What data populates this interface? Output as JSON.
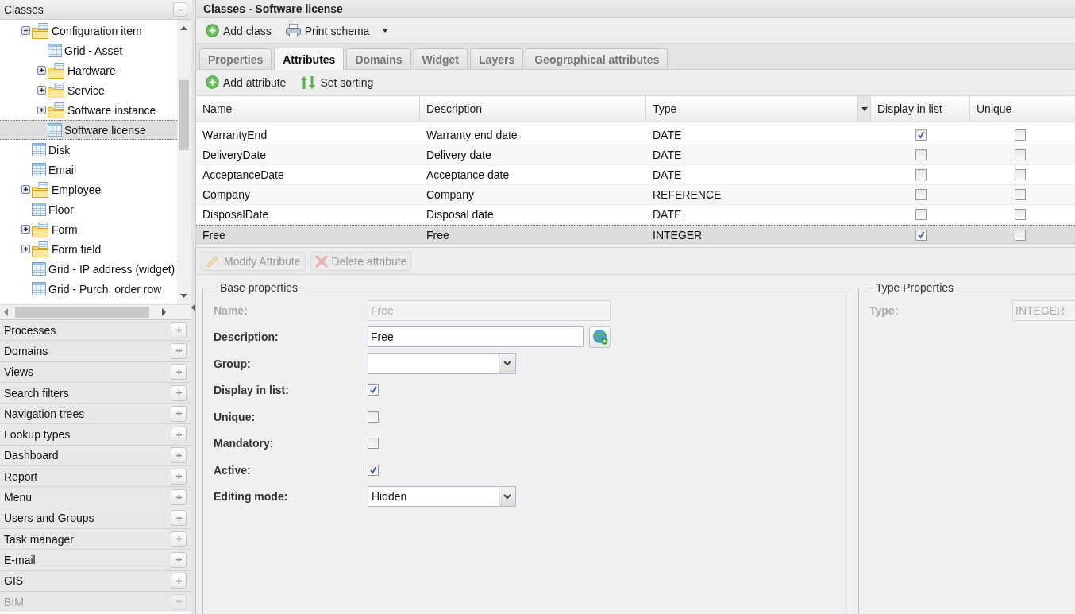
{
  "sidebar": {
    "title": "Classes",
    "tree": [
      {
        "label": "Configuration item",
        "kind": "folder",
        "expanded": true,
        "selected": false,
        "children": [
          {
            "label": "Grid - Asset",
            "kind": "class",
            "selected": false
          },
          {
            "label": "Hardware",
            "kind": "folder",
            "expanded": false,
            "selected": false
          },
          {
            "label": "Service",
            "kind": "folder",
            "expanded": false,
            "selected": false
          },
          {
            "label": "Software instance",
            "kind": "folder",
            "expanded": false,
            "selected": false
          },
          {
            "label": "Software license",
            "kind": "class",
            "selected": true
          }
        ]
      },
      {
        "label": "Disk",
        "kind": "class",
        "selected": false
      },
      {
        "label": "Email",
        "kind": "class",
        "selected": false
      },
      {
        "label": "Employee",
        "kind": "folder",
        "expanded": false,
        "selected": false
      },
      {
        "label": "Floor",
        "kind": "class",
        "selected": false
      },
      {
        "label": "Form",
        "kind": "folder",
        "expanded": false,
        "selected": false
      },
      {
        "label": "Form field",
        "kind": "folder",
        "expanded": false,
        "selected": false
      },
      {
        "label": "Grid - IP address (widget)",
        "kind": "class",
        "selected": false
      },
      {
        "label": "Grid - Purch. order row",
        "kind": "class",
        "selected": false
      }
    ],
    "sections": [
      {
        "label": "Processes",
        "disabled": false
      },
      {
        "label": "Domains",
        "disabled": false
      },
      {
        "label": "Views",
        "disabled": false
      },
      {
        "label": "Search filters",
        "disabled": false
      },
      {
        "label": "Navigation trees",
        "disabled": false
      },
      {
        "label": "Lookup types",
        "disabled": false
      },
      {
        "label": "Dashboard",
        "disabled": false
      },
      {
        "label": "Report",
        "disabled": false
      },
      {
        "label": "Menu",
        "disabled": false
      },
      {
        "label": "Users and Groups",
        "disabled": false
      },
      {
        "label": "Task manager",
        "disabled": false
      },
      {
        "label": "E-mail",
        "disabled": false
      },
      {
        "label": "GIS",
        "disabled": false
      },
      {
        "label": "BIM",
        "disabled": true
      }
    ]
  },
  "main": {
    "title": "Classes - Software license",
    "toolbar": [
      {
        "label": "Add class",
        "kind": "add",
        "menu": false
      },
      {
        "label": "Print schema",
        "kind": "print",
        "menu": true
      }
    ],
    "tabs": [
      {
        "label": "Properties",
        "selected": false
      },
      {
        "label": "Attributes",
        "selected": true
      },
      {
        "label": "Domains",
        "selected": false
      },
      {
        "label": "Widget",
        "selected": false
      },
      {
        "label": "Layers",
        "selected": false
      },
      {
        "label": "Geographical attributes",
        "selected": false
      }
    ],
    "attribute_toolbar": [
      {
        "label": "Add attribute",
        "kind": "add"
      },
      {
        "label": "Set sorting",
        "kind": "sort"
      }
    ],
    "grid": {
      "columns": [
        "Name",
        "Description",
        "Type",
        "Display in list",
        "Unique"
      ],
      "rows": [
        {
          "name": "WarrantyEnd",
          "description": "Warranty end date",
          "type": "DATE",
          "display_in_list": true,
          "unique": false,
          "selected": false
        },
        {
          "name": "DeliveryDate",
          "description": "Delivery date",
          "type": "DATE",
          "display_in_list": false,
          "unique": false,
          "selected": false
        },
        {
          "name": "AcceptanceDate",
          "description": "Acceptance date",
          "type": "DATE",
          "display_in_list": false,
          "unique": false,
          "selected": false
        },
        {
          "name": "Company",
          "description": "Company",
          "type": "REFERENCE",
          "display_in_list": false,
          "unique": false,
          "selected": false
        },
        {
          "name": "DisposalDate",
          "description": "Disposal date",
          "type": "DATE",
          "display_in_list": false,
          "unique": false,
          "selected": false
        },
        {
          "name": "Free",
          "description": "Free",
          "type": "INTEGER",
          "display_in_list": true,
          "unique": false,
          "selected": true
        }
      ]
    },
    "actions": [
      {
        "label": "Modify Attribute",
        "kind": "edit",
        "disabled": true
      },
      {
        "label": "Delete attribute",
        "kind": "delete",
        "disabled": true
      }
    ],
    "base_properties": {
      "title": "Base properties",
      "fields": [
        {
          "label": "Name:",
          "kind": "text",
          "value": "Free",
          "disabled": true
        },
        {
          "label": "Description:",
          "kind": "text",
          "value": "Free",
          "disabled": false,
          "translate": true
        },
        {
          "label": "Group:",
          "kind": "combo",
          "disabled": false
        },
        {
          "label": "Display in list:",
          "kind": "checkbox",
          "checked": true,
          "disabled": false
        },
        {
          "label": "Unique:",
          "kind": "checkbox",
          "checked": false,
          "disabled": false
        },
        {
          "label": "Mandatory:",
          "kind": "checkbox",
          "checked": false,
          "disabled": false
        },
        {
          "label": "Active:",
          "kind": "checkbox",
          "checked": true,
          "disabled": false
        },
        {
          "label": "Editing mode:",
          "kind": "combo",
          "value": "Hidden",
          "disabled": false
        }
      ]
    },
    "type_properties": {
      "title": "Type Properties",
      "fields": [
        {
          "label": "Type:",
          "kind": "text",
          "value": "INTEGER",
          "disabled": true
        }
      ]
    }
  }
}
